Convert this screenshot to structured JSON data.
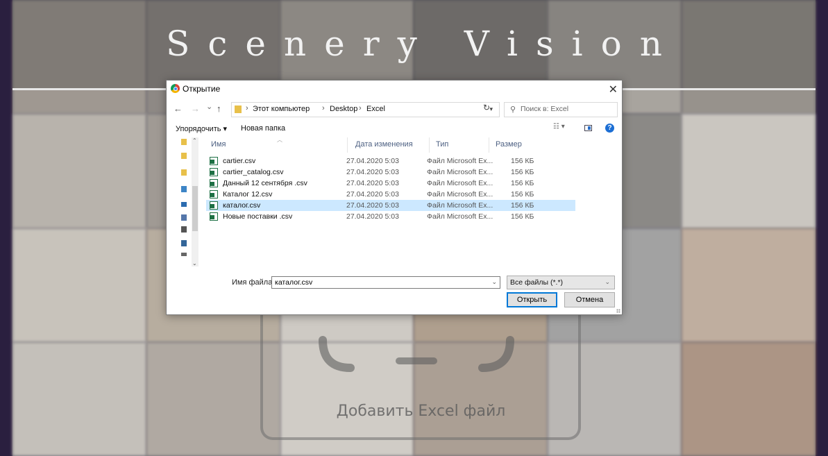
{
  "app": {
    "title": "Scenery Vision",
    "dropzone_label": "Добавить Excel файл"
  },
  "dialog": {
    "title": "Открытие",
    "close_label": "✕",
    "nav": {
      "back": "←",
      "forward": "→",
      "history": "⌄",
      "up": "↑",
      "refresh": "↻"
    },
    "breadcrumbs": [
      "Этот компьютер",
      "Desktop",
      "Excel"
    ],
    "search_placeholder": "Поиск в: Excel",
    "toolbar": {
      "organize": "Упорядочить ▾",
      "new_folder": "Новая папка",
      "view_icon": "☷ ▾",
      "help": "?"
    },
    "columns": {
      "name": "Имя",
      "date": "Дата изменения",
      "type": "Тип",
      "size": "Размер"
    },
    "files": [
      {
        "name": "cartier.csv",
        "date": "27.04.2020 5:03",
        "type": "Файл Microsoft Ex...",
        "size": "156 КБ"
      },
      {
        "name": "cartier_catalog.csv",
        "date": "27.04.2020 5:03",
        "type": "Файл Microsoft Ex...",
        "size": "156 КБ"
      },
      {
        "name": "Данный 12 сентября .csv",
        "date": "27.04.2020 5:03",
        "type": "Файл Microsoft Ex...",
        "size": "156 КБ"
      },
      {
        "name": "Каталог 12.csv",
        "date": "27.04.2020 5:03",
        "type": "Файл Microsoft Ex...",
        "size": "156 КБ"
      },
      {
        "name": "каталог.csv",
        "date": "27.04.2020 5:03",
        "type": "Файл Microsoft Ex...",
        "size": "156 КБ"
      },
      {
        "name": "Новые поставки .csv",
        "date": "27.04.2020 5:03",
        "type": "Файл Microsoft Ex...",
        "size": "156 КБ"
      }
    ],
    "selected_index": 4,
    "filename_label": "Имя файла:",
    "filename_value": "каталог.csv",
    "filetype": "Все файлы (*.*)",
    "open_button": "Открыть",
    "cancel_button": "Отмена"
  },
  "colors": {
    "accent": "#0078d7",
    "selection": "#cce8ff",
    "header_text": "#4d6082",
    "page_border": "#2a1f3f"
  }
}
